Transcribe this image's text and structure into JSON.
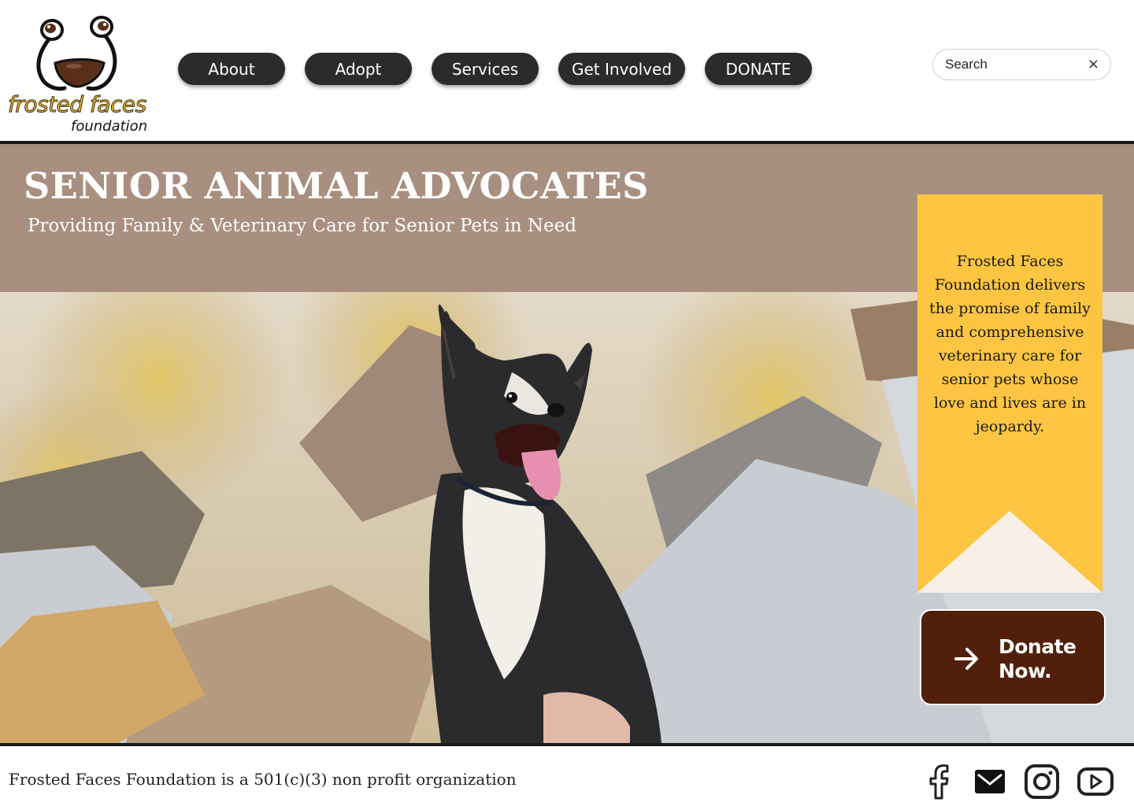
{
  "brand": {
    "name_line1": "frosted faces",
    "name_line2": "foundation",
    "logo_colors": {
      "gold": "#f3bd2e",
      "brown": "#5a2f1a",
      "black": "#111111"
    }
  },
  "nav": {
    "items": [
      {
        "label": "About"
      },
      {
        "label": "Adopt"
      },
      {
        "label": "Services"
      },
      {
        "label": "Get Involved"
      },
      {
        "label": "DONATE"
      }
    ]
  },
  "search": {
    "placeholder": "Search",
    "clear_icon": "×"
  },
  "hero": {
    "title": "SENIOR ANIMAL ADVOCATES",
    "subtitle": "Providing Family & Veterinary Care for Senior Pets in Need",
    "mission": "Frosted Faces Foundation delivers the promise of family and comprehensive veterinary care for senior pets whose love and lives are in jeopardy.",
    "donate_label": "Donate Now.",
    "colors": {
      "band": "#a68b7c",
      "mission_bg": "#fdc542",
      "donate_bg": "#52200a",
      "ribbon_notch": "#f8efe6"
    }
  },
  "footer": {
    "text": "Frosted Faces Foundation is a 501(c)(3) non profit organization",
    "social_icons": [
      "facebook-icon",
      "email-icon",
      "instagram-icon",
      "youtube-icon"
    ]
  }
}
